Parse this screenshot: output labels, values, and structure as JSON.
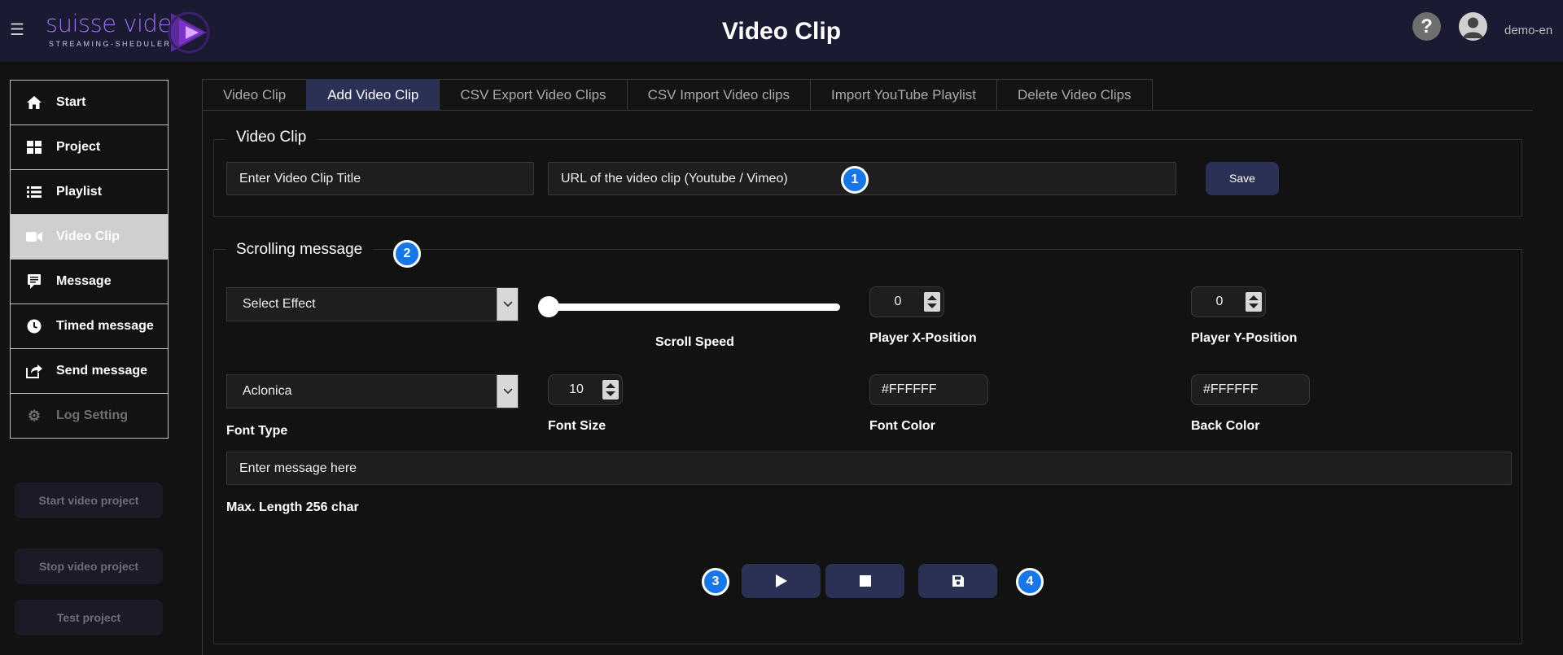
{
  "header": {
    "logo_text": "suisse video",
    "logo_sub": "STREAMING-SHEDULER",
    "title": "Video Clip",
    "help_glyph": "?",
    "user": "demo-en"
  },
  "sidebar": {
    "items": [
      {
        "label": "Start",
        "icon": "home-icon"
      },
      {
        "label": "Project",
        "icon": "grid-icon"
      },
      {
        "label": "Playlist",
        "icon": "list-icon"
      },
      {
        "label": "Video Clip",
        "icon": "video-camera-icon"
      },
      {
        "label": "Message",
        "icon": "message-icon"
      },
      {
        "label": "Timed message",
        "icon": "clock-icon"
      },
      {
        "label": "Send message",
        "icon": "share-icon"
      },
      {
        "label": "Log Setting",
        "icon": "cogs-icon"
      }
    ],
    "buttons": {
      "start": "Start video project",
      "stop": "Stop video project",
      "test": "Test project"
    }
  },
  "tabs": [
    "Video Clip",
    "Add Video Clip",
    "CSV Export Video Clips",
    "CSV Import Video clips",
    "Import YouTube Playlist",
    "Delete Video Clips"
  ],
  "video_clip": {
    "legend": "Video Clip",
    "title_placeholder": "Enter Video Clip Title",
    "url_placeholder": "URL of the video clip (Youtube / Vimeo)",
    "save_label": "Save"
  },
  "scrolling": {
    "legend": "Scrolling message",
    "effect_selected": "Select Effect",
    "scroll_speed_label": "Scroll Speed",
    "scroll_speed_value": 0,
    "player_x_value": "0",
    "player_x_label": "Player X-Position",
    "player_y_value": "0",
    "player_y_label": "Player Y-Position",
    "font_selected": "Aclonica",
    "font_type_label": "Font Type",
    "font_size_value": "10",
    "font_size_label": "Font Size",
    "font_color_value": "#FFFFFF",
    "font_color_label": "Font Color",
    "back_color_value": "#FFFFFF",
    "back_color_label": "Back Color",
    "message_placeholder": "Enter message here",
    "max_length_label": "Max. Length 256 char"
  },
  "badges": [
    "1",
    "2",
    "3",
    "4"
  ],
  "colors": {
    "header_bg": "#1a1a33",
    "accent": "#2b3154",
    "badge": "#1877e6",
    "logo": "#9b6cf0"
  }
}
